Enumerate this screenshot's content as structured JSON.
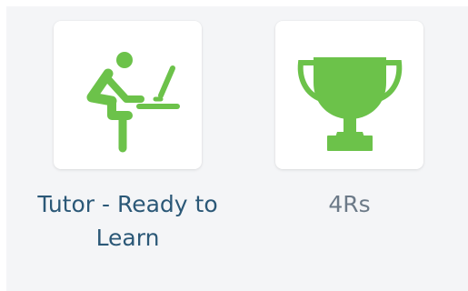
{
  "tiles": [
    {
      "label": "Tutor - Ready to Learn",
      "icon": "student-at-desk-icon",
      "icon_color": "#6cc24a"
    },
    {
      "label": "4Rs",
      "icon": "trophy-icon",
      "icon_color": "#6cc24a"
    }
  ]
}
